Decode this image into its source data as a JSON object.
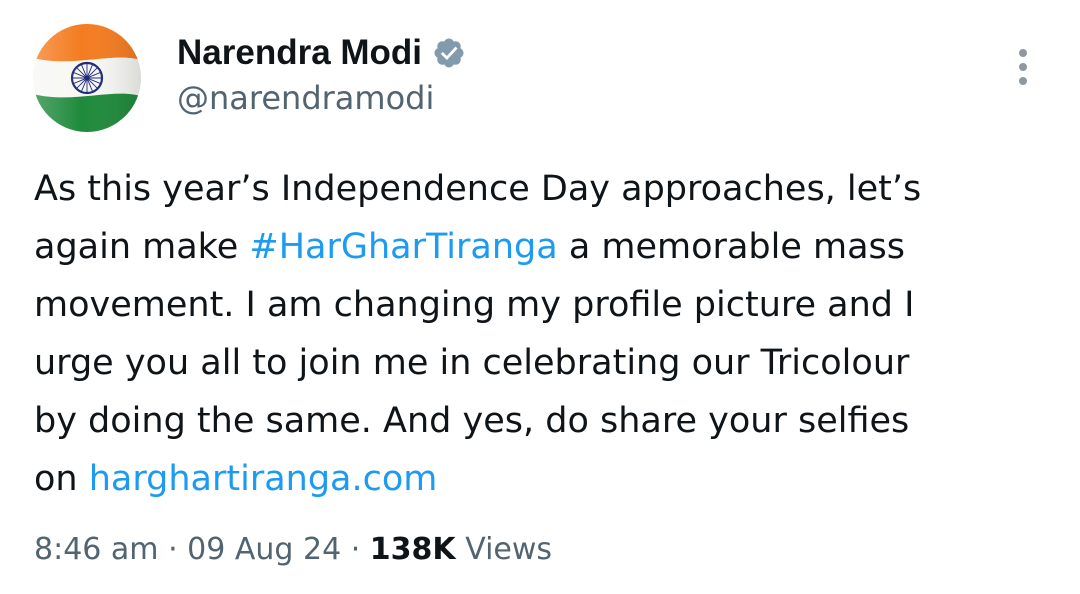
{
  "author": {
    "display_name": "Narendra Modi",
    "handle": "@narendramodi",
    "avatar_icon": "tricolour-flag-avatar",
    "verified_icon": "verified-badge-icon",
    "verified_color": "#829aab"
  },
  "tweet": {
    "line1": "As this year’s Independence Day approaches, let’s",
    "line2_before": "again make ",
    "hashtag": "#HarGharTiranga",
    "line2_after": " a memorable mass",
    "line3": "movement. I am changing my profile picture and I",
    "line4": "urge you all to join me in celebrating our Tricolour",
    "line5": "by doing the same. And yes, do share your selfies",
    "line6_before": "on ",
    "link": "harghartiranga.com"
  },
  "meta": {
    "time": "8:46 am",
    "separator": "·",
    "date": "09 Aug 24",
    "views_count": "138K",
    "views_label": "Views"
  },
  "colors": {
    "link": "#1d9bf0",
    "secondary_text": "#536471",
    "saffron": "#f47c20",
    "green": "#1f8a3b",
    "chakra": "#1e2a78"
  }
}
